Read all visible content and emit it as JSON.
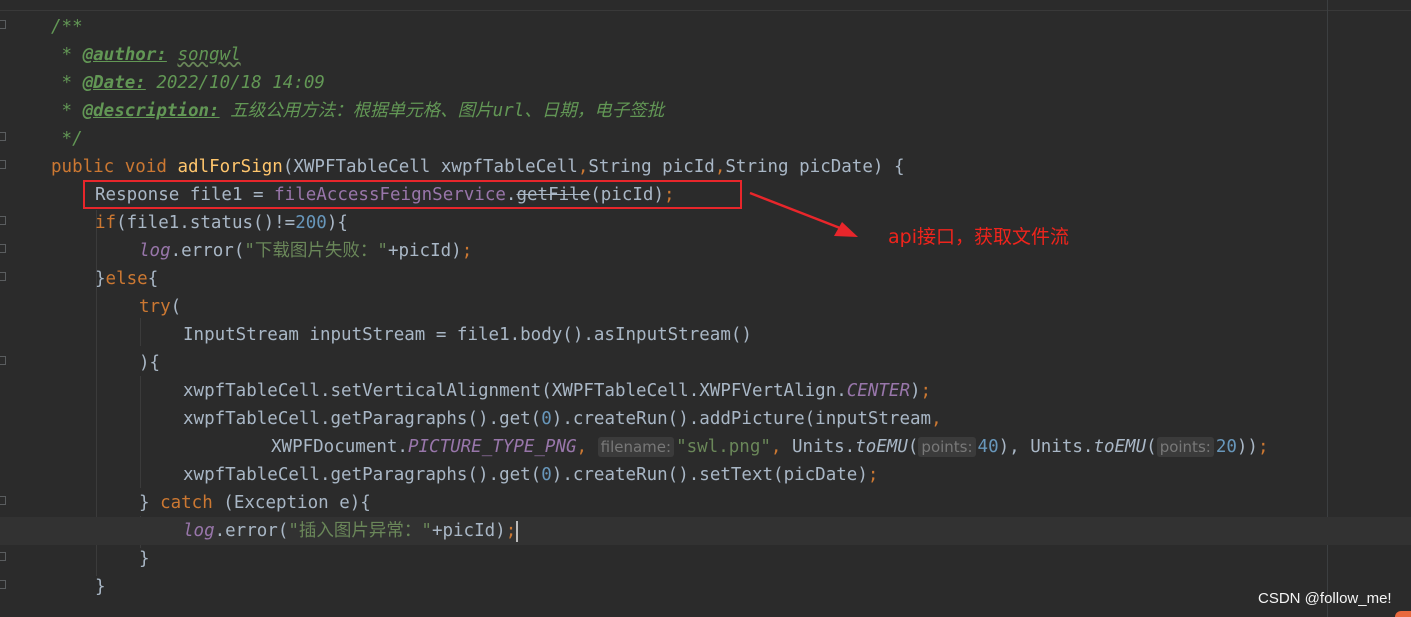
{
  "code": {
    "doc_open": "/**",
    "author_prefix": " * ",
    "author_tag": "@author:",
    "author_value": "songwl",
    "date_prefix": " * ",
    "date_tag": "@Date:",
    "date_value": " 2022/10/18 14:09",
    "desc_prefix": " * ",
    "desc_tag": "@description:",
    "desc_value": " 五级公用方法：根据单元格、图片url、日期，电子签批",
    "doc_close": " */",
    "method": {
      "kw_public": "public",
      "sp1": " ",
      "kw_void": "void",
      "sp2": " ",
      "name": "adlForSign",
      "params": "(XWPFTableCell xwpfTableCell",
      "comma1": ",",
      "p2": "String picId",
      "comma2": ",",
      "p3": "String picDate) {"
    },
    "line_response": {
      "a": "Response file1 = ",
      "service": "fileAccessFeignService",
      "dot": ".",
      "call": "getFile",
      "b": "(picId)",
      "semi": ";"
    },
    "line_if": {
      "kw": "if",
      "a": "(file1.status()!=",
      "num": "200",
      "b": "){"
    },
    "line_log1": {
      "field": "log",
      "a": ".error(",
      "str": "\"下载图片失败：\"",
      "b": "+picId)",
      "semi": ";"
    },
    "line_else": {
      "a": "}",
      "kw": "else",
      "b": "{"
    },
    "line_try": {
      "kw": "try",
      "b": "("
    },
    "line_stream": "InputStream inputStream = file1.body().asInputStream()",
    "line_close_paren": "){",
    "line_align": {
      "a": "xwpfTableCell.setVerticalAlignment(XWPFTableCell.XWPFVertAlign.",
      "const": "CENTER",
      "b": ")",
      "semi": ";"
    },
    "line_add_picture": {
      "a": "xwpfTableCell.getParagraphs().get(",
      "num": "0",
      "b": ").createRun().addPicture(inputStream",
      "comma": ","
    },
    "line_picture_args": {
      "a": "XWPFDocument.",
      "const": "PICTURE_TYPE_PNG",
      "comma1": ", ",
      "hint1": "filename:",
      "str": "\"swl.png\"",
      "comma2": ", ",
      "b": "Units.",
      "fn1": "toEMU",
      "paren1": "(",
      "hint2": "points:",
      "num1": "40",
      "c": "), Units.",
      "fn2": "toEMU",
      "paren2": "(",
      "hint3": "points:",
      "num2": "20",
      "d": "))",
      "semi": ";"
    },
    "line_set_text": {
      "a": "xwpfTableCell.getParagraphs().get(",
      "num": "0",
      "b": ").createRun().setText(picDate)",
      "semi": ";"
    },
    "line_catch": {
      "a": "} ",
      "kw": "catch",
      "b": " (Exception e){"
    },
    "line_log2": {
      "field": "log",
      "a": ".error(",
      "str": "\"插入图片异常：\"",
      "b": "+picId)",
      "semi": ";"
    },
    "line_brace1": "}",
    "line_brace2": "}"
  },
  "annotation": "api接口，获取文件流",
  "watermark": "CSDN @follow_me!",
  "colors": {
    "background": "#2b2b2b",
    "keyword": "#cc7832",
    "function": "#ffc66d",
    "string": "#6a8759",
    "number": "#6897bb",
    "field": "#9876aa",
    "doc": "#629755",
    "annotation_red": "#e8262b"
  }
}
